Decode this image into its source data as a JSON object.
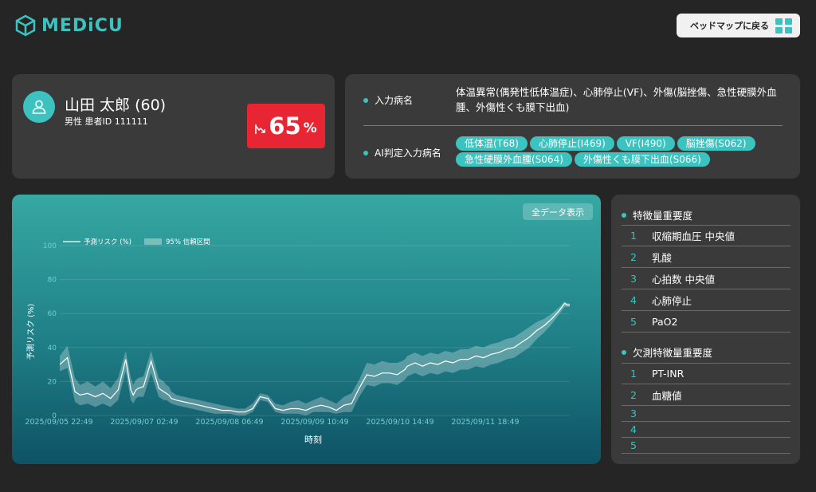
{
  "header": {
    "logo_text": "MEDiCU",
    "back_button": "ベッドマップに戻る"
  },
  "patient": {
    "name": "山田 太郎 (60)",
    "sub": "男性 患者ID 111111",
    "risk_value": "65",
    "risk_unit": "%"
  },
  "diagnosis": {
    "input_label": "入力病名",
    "input_text": "体温異常(偶発性低体温症)、心肺停止(VF)、外傷(脳挫傷、急性硬膜外血腫、外傷性くも膜下出血)",
    "ai_label": "AI判定入力病名",
    "tags": [
      "低体温(T68)",
      "心肺停止(I469)",
      "VF(I490)",
      "脳挫傷(S062)",
      "急性硬膜外血腫(S064)",
      "外傷性くも膜下出血(S066)"
    ]
  },
  "chart": {
    "all_data_button": "全データ表示"
  },
  "chart_data": {
    "type": "line",
    "xlabel": "時刻",
    "ylabel": "予測リスク (%)",
    "ylim": [
      0,
      100
    ],
    "yticks": [
      0,
      20,
      40,
      60,
      80,
      100
    ],
    "xtick_labels": [
      "2025/09/05 22:49",
      "2025/09/07 02:49",
      "2025/09/08 06:49",
      "2025/09/09 10:49",
      "2025/09/10 14:49",
      "2025/09/11 18:49"
    ],
    "legend": [
      "予測リスク (%)",
      "95% 信頼区間"
    ],
    "legend_position": "top-left",
    "series": [
      {
        "name": "予測リスク (%)",
        "x_hours": [
          0,
          3,
          6,
          8,
          11,
          14,
          17,
          20,
          23,
          26,
          28,
          29,
          30,
          31,
          33,
          36,
          39,
          41,
          42,
          43,
          44,
          46,
          49,
          52,
          55,
          58,
          61,
          64,
          67,
          70,
          73,
          76,
          79,
          82,
          85,
          88,
          91,
          94,
          97,
          100,
          103,
          106,
          109,
          112,
          115,
          118,
          121,
          124,
          127,
          130,
          133,
          135,
          136,
          137,
          140,
          143,
          146,
          149,
          152,
          155,
          158,
          161,
          164,
          167,
          170,
          173,
          176,
          179,
          182,
          185,
          188,
          191,
          194,
          197,
          199,
          200,
          201
        ],
        "values": [
          30,
          34,
          14,
          12,
          13,
          11,
          13,
          10,
          15,
          33,
          15,
          12,
          15,
          16,
          17,
          32,
          16,
          14,
          13,
          12,
          10,
          9,
          8,
          7,
          6,
          5,
          4,
          3,
          3,
          2,
          2,
          4,
          11,
          10,
          4,
          3,
          4,
          4,
          3,
          5,
          6,
          5,
          3,
          6,
          7,
          16,
          24,
          23,
          25,
          25,
          24,
          26,
          27,
          29,
          31,
          29,
          31,
          30,
          32,
          31,
          33,
          33,
          35,
          34,
          36,
          37,
          39,
          40,
          43,
          46,
          50,
          53,
          57,
          62,
          66,
          65,
          65
        ],
        "lower": [
          26,
          28,
          8,
          6,
          7,
          5,
          7,
          5,
          9,
          26,
          9,
          7,
          10,
          11,
          11,
          25,
          11,
          9,
          9,
          8,
          7,
          6,
          5,
          4,
          3,
          2,
          1,
          1,
          1,
          0,
          0,
          2,
          9,
          8,
          2,
          1,
          1,
          1,
          0,
          2,
          2,
          2,
          1,
          2,
          2,
          11,
          18,
          17,
          19,
          19,
          18,
          20,
          21,
          23,
          25,
          23,
          25,
          24,
          26,
          25,
          27,
          27,
          29,
          28,
          30,
          31,
          33,
          34,
          37,
          40,
          45,
          49,
          54,
          60,
          64,
          64,
          64
        ],
        "upper": [
          35,
          41,
          22,
          18,
          20,
          17,
          20,
          16,
          22,
          38,
          22,
          18,
          21,
          22,
          23,
          38,
          22,
          20,
          18,
          17,
          14,
          12,
          11,
          10,
          9,
          8,
          7,
          6,
          5,
          4,
          4,
          7,
          13,
          12,
          7,
          6,
          8,
          9,
          7,
          9,
          11,
          9,
          7,
          11,
          13,
          21,
          31,
          30,
          32,
          31,
          31,
          32,
          33,
          35,
          37,
          35,
          37,
          36,
          38,
          37,
          39,
          39,
          41,
          40,
          42,
          43,
          45,
          46,
          49,
          52,
          55,
          57,
          60,
          64,
          67,
          66,
          66
        ]
      }
    ]
  },
  "features": {
    "title": "特徴量重要度",
    "items": [
      {
        "n": "1",
        "label": "収縮期血圧 中央値"
      },
      {
        "n": "2",
        "label": "乳酸"
      },
      {
        "n": "3",
        "label": "心拍数 中央値"
      },
      {
        "n": "4",
        "label": "心肺停止"
      },
      {
        "n": "5",
        "label": "PaO2"
      }
    ],
    "missing_title": "欠測特徴量重要度",
    "missing_items": [
      {
        "n": "1",
        "label": "PT-INR"
      },
      {
        "n": "2",
        "label": "血糖値"
      },
      {
        "n": "3",
        "label": ""
      },
      {
        "n": "4",
        "label": ""
      },
      {
        "n": "5",
        "label": ""
      }
    ]
  },
  "colors": {
    "accent": "#3cc3bf",
    "risk": "#e82533",
    "background": "#252525",
    "card": "#3a3a3a"
  }
}
